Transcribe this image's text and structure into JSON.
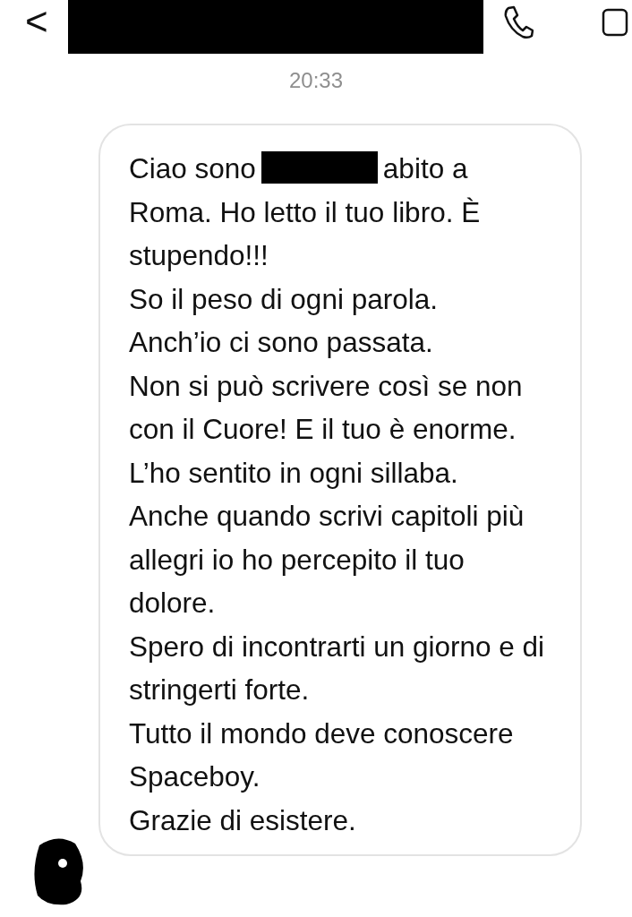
{
  "header": {
    "back": "<",
    "name_redacted": true
  },
  "timestamp": "20:33",
  "message": {
    "intro": {
      "before": "Ciao sono",
      "after": "abito a",
      "rest": "Roma. Ho letto il tuo libro. È stupendo!!!"
    },
    "paragraphs": [
      "So il peso di ogni parola.",
      "Anch’io ci sono passata.",
      "Non si può scrivere così se non con il Cuore! E il tuo è enorme. L’ho sentito in ogni sillaba.",
      "Anche quando scrivi capitoli più allegri io ho percepito il tuo dolore.",
      "Spero di incontrarti un giorno e di stringerti forte.",
      "Tutto il mondo deve conoscere Spaceboy.",
      "Grazie di esistere."
    ]
  }
}
